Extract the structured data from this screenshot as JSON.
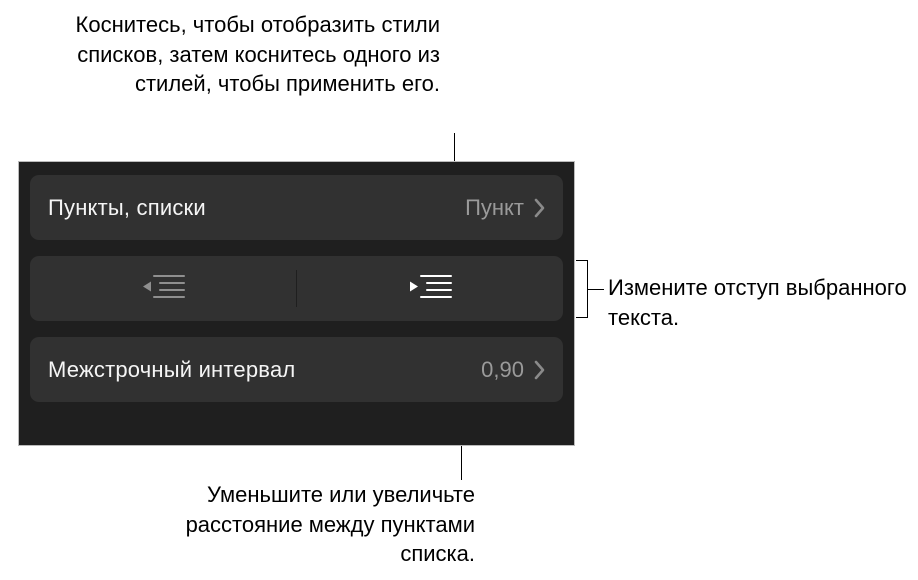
{
  "callouts": {
    "top": "Коснитесь, чтобы отобразить стили списков, затем коснитесь одного из стилей, чтобы применить его.",
    "right": "Измените отступ выбранного текста.",
    "bottom": "Уменьшите или увеличьте расстояние между пунктами списка."
  },
  "panel": {
    "bullets": {
      "label": "Пункты, списки",
      "value": "Пункт"
    },
    "lineSpacing": {
      "label": "Межстрочный интервал",
      "value": "0,90"
    }
  }
}
